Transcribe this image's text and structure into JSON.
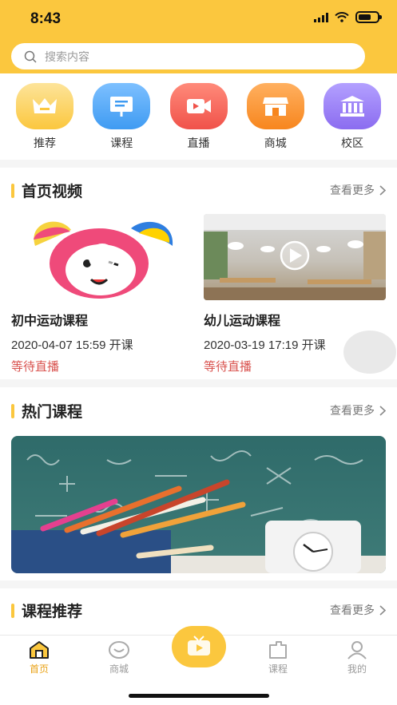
{
  "status_bar": {
    "time": "8:43"
  },
  "search": {
    "placeholder": "搜索内容"
  },
  "categories": [
    {
      "label": "推荐",
      "icon": "crown-icon",
      "color": "#fbc73e"
    },
    {
      "label": "课程",
      "icon": "presentation-icon",
      "color": "#3f9bf2"
    },
    {
      "label": "直播",
      "icon": "video-camera-icon",
      "color": "#f0524a"
    },
    {
      "label": "商城",
      "icon": "store-icon",
      "color": "#f7861e"
    },
    {
      "label": "校区",
      "icon": "school-building-icon",
      "color": "#8b6cf0"
    }
  ],
  "home_video": {
    "title": "首页视频",
    "more_label": "查看更多",
    "items": [
      {
        "title": "初中运动课程",
        "datetime": "2020-04-07 15:59 开课",
        "status": "等待直播"
      },
      {
        "title": "幼儿运动课程",
        "datetime": "2020-03-19 17:19 开课",
        "status": "等待直播"
      }
    ]
  },
  "hot_courses": {
    "title": "热门课程",
    "more_label": "查看更多"
  },
  "course_recommend": {
    "title": "课程推荐",
    "more_label": "查看更多"
  },
  "tabbar": {
    "items": [
      {
        "label": "首页",
        "icon": "home-icon",
        "active": true
      },
      {
        "label": "商城",
        "icon": "shop-icon",
        "active": false
      },
      {
        "label": "",
        "icon": "tv-icon",
        "active": false
      },
      {
        "label": "课程",
        "icon": "course-icon",
        "active": false
      },
      {
        "label": "我的",
        "icon": "user-icon",
        "active": false
      }
    ]
  },
  "colors": {
    "accent": "#fbc73e",
    "status_text": "#d9534f",
    "active_tab": "#e9a216"
  }
}
